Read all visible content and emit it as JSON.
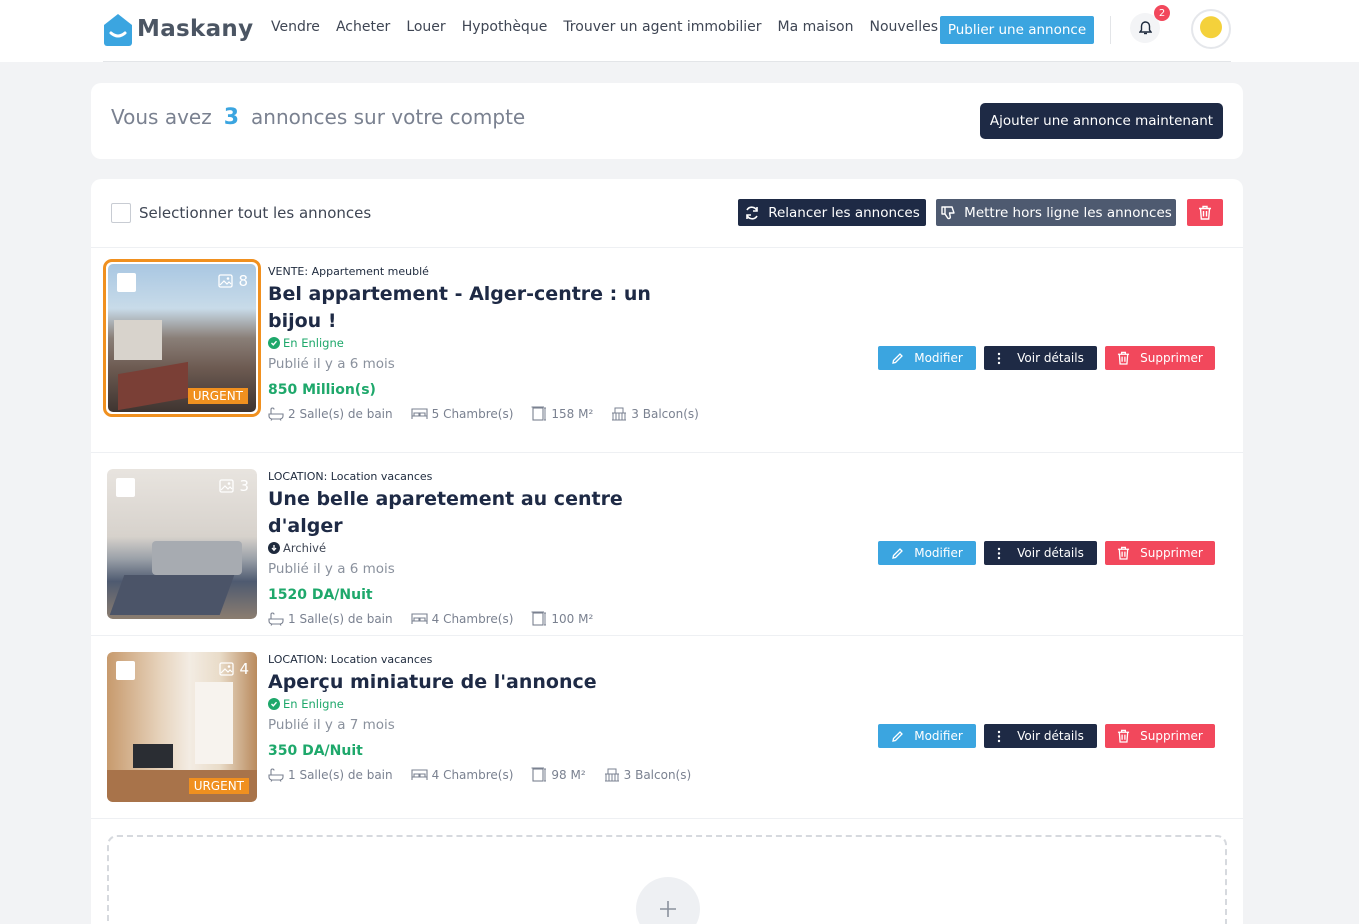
{
  "header": {
    "logo_text": "Maskany",
    "nav": [
      "Vendre",
      "Acheter",
      "Louer",
      "Hypothèque",
      "Trouver un agent immobilier",
      "Ma maison",
      "Nouvelles"
    ],
    "publish_label": "Publier une annonce",
    "notification_count": "2"
  },
  "summary": {
    "prefix": "Vous avez",
    "count": "3",
    "suffix": "annonces sur votre compte",
    "add_button": "Ajouter une annonce maintenant"
  },
  "toolbar": {
    "select_all_label": "Selectionner tout les annonces",
    "relaunch_label": "Relancer les annonces",
    "offline_label": "Mettre hors ligne les annonces"
  },
  "listings": [
    {
      "category": "VENTE: Appartement meublé",
      "title": "Bel appartement - Alger-centre : un bijou !",
      "status": "En Enligne",
      "published": "Publié il y a 6 mois",
      "price": "850 Million(s)",
      "photo_count": "8",
      "urgent": "URGENT",
      "bath": "2 Salle(s) de bain",
      "rooms": "5 Chambre(s)",
      "area": "158 M²",
      "balcony": "3 Balcon(s)"
    },
    {
      "category": "LOCATION: Location vacances",
      "title": "Une belle aparetement au centre d'alger",
      "status": "Archivé",
      "published": "Publié il y a 6 mois",
      "price": "1520 DA/Nuit",
      "photo_count": "3",
      "bath": "1 Salle(s) de bain",
      "rooms": "4 Chambre(s)",
      "area": "100 M²"
    },
    {
      "category": "LOCATION: Location vacances",
      "title": "Aperçu miniature de l'annonce",
      "status": "En Enligne",
      "published": "Publié il y a 7 mois",
      "price": "350 DA/Nuit",
      "photo_count": "4",
      "urgent": "URGENT",
      "bath": "1 Salle(s) de bain",
      "rooms": "4 Chambre(s)",
      "area": "98 M²",
      "balcony": "3 Balcon(s)"
    }
  ],
  "row_actions": {
    "edit": "Modifier",
    "details": "Voir détails",
    "delete": "Supprimer"
  },
  "colors": {
    "primary": "#3ba5e0",
    "dark": "#1e2a45",
    "danger": "#f2485c",
    "success": "#1ea86b",
    "urgent": "#f0901f"
  }
}
